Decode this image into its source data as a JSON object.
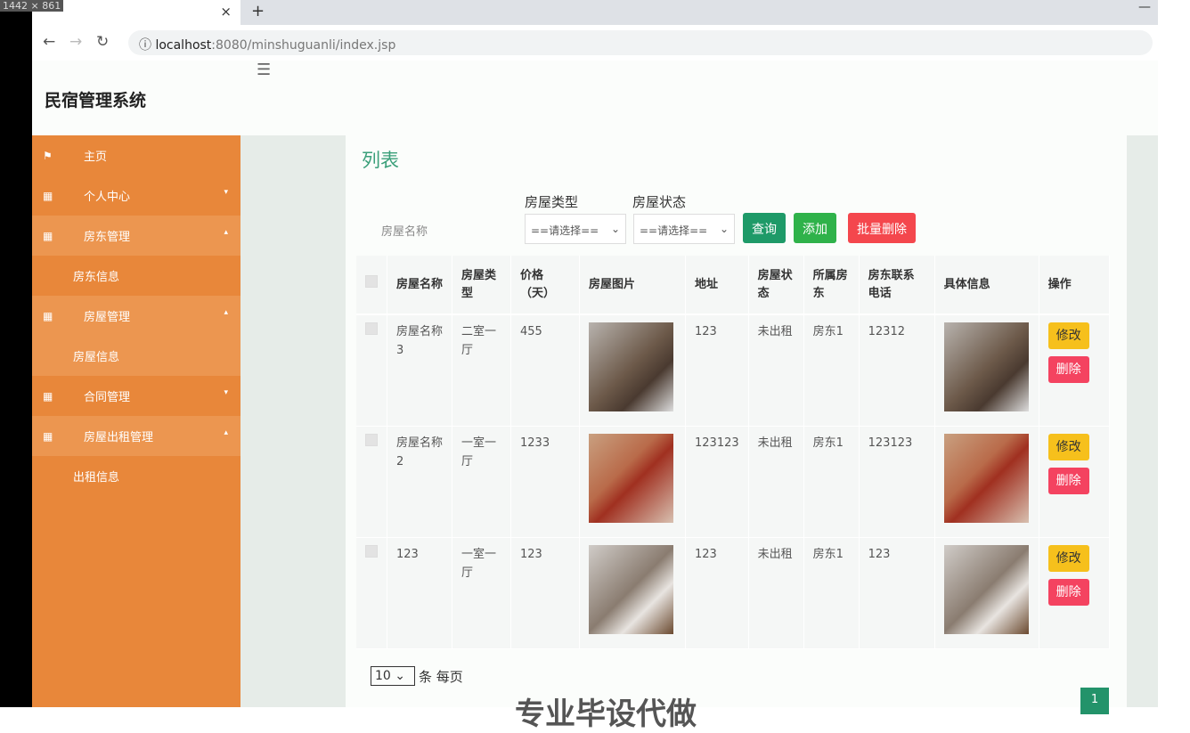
{
  "browser": {
    "dims": "1442 × 861",
    "url_host": "localhost",
    "url_path": ":8080/minshuguanli/index.jsp",
    "close": "×",
    "newtab": "+",
    "minimize": "—"
  },
  "app": {
    "title": "民宿管理系统"
  },
  "sidebar": {
    "items": [
      {
        "label": "主页",
        "icon": "flag"
      },
      {
        "label": "个人中心",
        "icon": "grid"
      },
      {
        "label": "房东管理",
        "icon": "grid"
      },
      {
        "label": "房东信息",
        "sub": true
      },
      {
        "label": "房屋管理",
        "icon": "grid"
      },
      {
        "label": "房屋信息",
        "sub": true
      },
      {
        "label": "合同管理",
        "icon": "grid"
      },
      {
        "label": "房屋出租管理",
        "icon": "grid"
      },
      {
        "label": "出租信息",
        "sub": true
      }
    ]
  },
  "main": {
    "title": "列表",
    "filters": {
      "name_placeholder": "房屋名称",
      "type_label": "房屋类型",
      "type_value": "==请选择==",
      "status_label": "房屋状态",
      "status_value": "==请选择=="
    },
    "buttons": {
      "search": "查询",
      "add": "添加",
      "batch_delete": "批量删除"
    },
    "columns": [
      "房屋名称",
      "房屋类型",
      "价格（天）",
      "房屋图片",
      "地址",
      "房屋状态",
      "所属房东",
      "房东联系电话",
      "具体信息",
      "操作"
    ],
    "rows": [
      {
        "name": "房屋名称3",
        "type": "二室一厅",
        "price": "455",
        "address": "123",
        "status": "未出租",
        "landlord": "房东1",
        "phone": "12312"
      },
      {
        "name": "房屋名称2",
        "type": "一室一厅",
        "price": "1233",
        "address": "123123",
        "status": "未出租",
        "landlord": "房东1",
        "phone": "123123"
      },
      {
        "name": "123",
        "type": "一室一厅",
        "price": "123",
        "address": "123",
        "status": "未出租",
        "landlord": "房东1",
        "phone": "123"
      }
    ],
    "edit": "修改",
    "delete": "删除",
    "page_size": "10",
    "page_size_suffix": "条 每页",
    "page": "1",
    "watermark": "专业毕设代做"
  }
}
